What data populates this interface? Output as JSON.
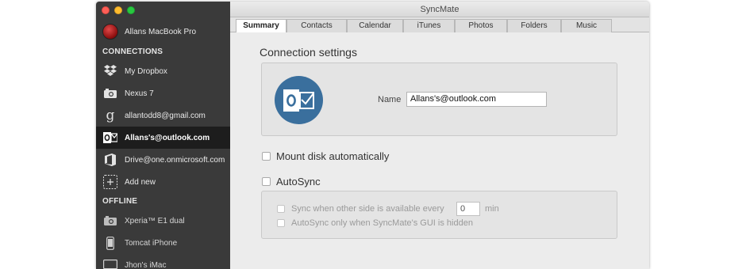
{
  "window": {
    "title": "SyncMate"
  },
  "sidebar": {
    "mac_name": "Allans MacBook Pro",
    "connections_header": "CONNECTIONS",
    "connections": [
      {
        "label": "My Dropbox",
        "icon": "dropbox-icon"
      },
      {
        "label": "Nexus 7",
        "icon": "camera-icon"
      },
      {
        "label": "allantodd8@gmail.com",
        "icon": "google-icon"
      },
      {
        "label": "Allans's@outlook.com",
        "icon": "outlook-icon",
        "selected": true
      },
      {
        "label": "Drive@one.onmicrosoft.com",
        "icon": "office-icon"
      },
      {
        "label": "Add new",
        "icon": "add-icon"
      }
    ],
    "offline_header": "OFFLINE",
    "offline": [
      {
        "label": "Xperia™ E1 dual",
        "icon": "camera-icon"
      },
      {
        "label": "Tomcat iPhone",
        "icon": "iphone-icon"
      },
      {
        "label": "Jhon's iMac",
        "icon": "imac-icon"
      }
    ]
  },
  "tabs": [
    "Summary",
    "Contacts",
    "Calendar",
    "iTunes",
    "Photos",
    "Folders",
    "Music"
  ],
  "content": {
    "connection_settings_title": "Connection settings",
    "name_label": "Name",
    "name_value": "Allans's@outlook.com",
    "mount_disk_label": "Mount disk automatically",
    "autosync_label": "AutoSync",
    "sync_when_label": "Sync when other side is available every",
    "sync_interval_value": "0",
    "min_label": "min",
    "autosync_hidden_label": "AutoSync only when SyncMate's GUI is hidden"
  },
  "colors": {
    "sidebar_bg": "#3a3a3a",
    "selected_bg": "#1d1d1d",
    "outlook_blue": "#3a6f9d"
  }
}
